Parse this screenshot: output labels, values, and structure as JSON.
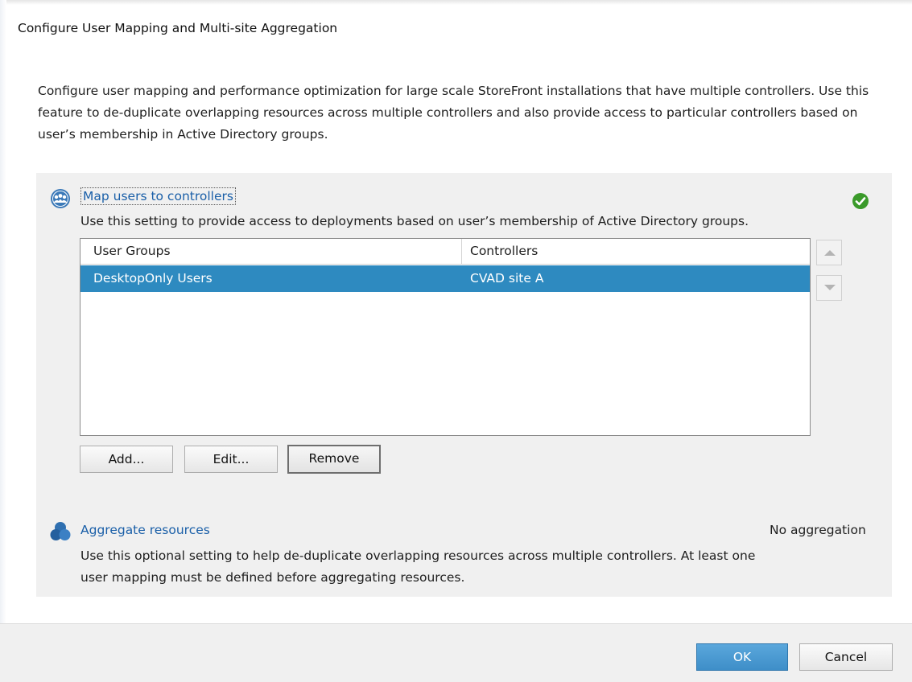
{
  "dialog": {
    "title": "Configure User Mapping and Multi-site Aggregation",
    "intro": "Configure user mapping and performance optimization for large scale StoreFront installations that have multiple controllers. Use this feature to de-duplicate overlapping resources across multiple controllers and also provide access to particular controllers based on user’s membership in Active Directory groups."
  },
  "map_section": {
    "title": "Map users to controllers",
    "description": "Use this setting to provide access to deployments based on user’s membership of Active Directory groups.",
    "icon": "users-group-icon",
    "status_icon": "check-circle-icon",
    "table": {
      "headers": [
        "User Groups",
        "Controllers"
      ],
      "rows": [
        {
          "user_group": "DesktopOnly Users",
          "controller": "CVAD site A",
          "selected": true
        }
      ]
    },
    "buttons": {
      "add": "Add...",
      "edit": "Edit...",
      "remove": "Remove"
    },
    "move_up_icon": "triangle-up-icon",
    "move_down_icon": "triangle-down-icon"
  },
  "aggregate_section": {
    "title": "Aggregate resources",
    "status": "No aggregation",
    "description": "Use this optional setting to help de-duplicate overlapping resources across multiple controllers. At least one user mapping must be defined before aggregating resources.",
    "icon": "aggregate-circles-icon"
  },
  "footer": {
    "ok": "OK",
    "cancel": "Cancel"
  },
  "colors": {
    "selection": "#2e8ac0",
    "link": "#1a5fa8",
    "ok_button": "#4a9ad4",
    "check": "#3a9a2a"
  }
}
